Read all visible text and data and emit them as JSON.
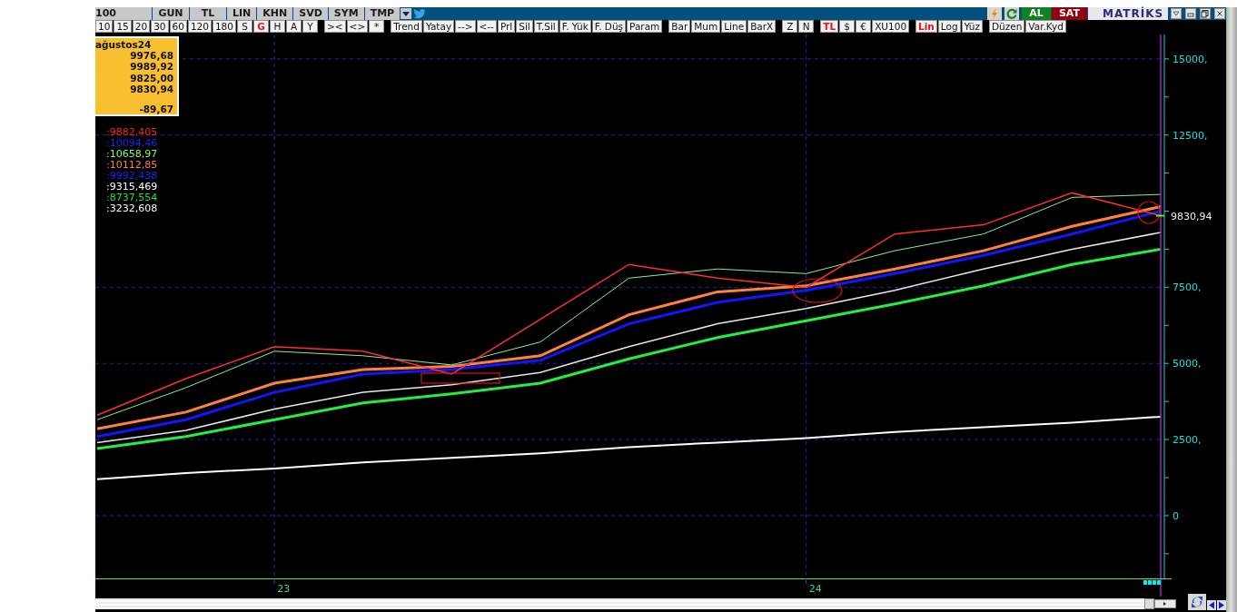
{
  "toolbar_top": {
    "left_items": [
      {
        "label": "100"
      },
      {
        "label": "GUN"
      },
      {
        "label": "TL"
      },
      {
        "label": "LIN"
      },
      {
        "label": "KHN"
      },
      {
        "label": "SVD"
      },
      {
        "label": "SYM"
      },
      {
        "label": "TMP"
      }
    ],
    "right_buttons": [
      {
        "label": "AL",
        "kind": "buy"
      },
      {
        "label": "SAT",
        "kind": "sell"
      }
    ],
    "logo": "MATRİKS"
  },
  "toolbar_bottom": {
    "groups": [
      [
        {
          "label": "10",
          "selected": false
        },
        {
          "label": "15",
          "selected": false
        },
        {
          "label": "20",
          "selected": false
        },
        {
          "label": "30",
          "selected": false
        },
        {
          "label": "60",
          "selected": false
        },
        {
          "label": "120",
          "selected": false
        },
        {
          "label": "180",
          "selected": false
        },
        {
          "label": "S",
          "selected": false
        },
        {
          "label": "G",
          "selected": true
        },
        {
          "label": "H",
          "selected": false
        },
        {
          "label": "A",
          "selected": false
        },
        {
          "label": "Y",
          "selected": false
        }
      ],
      [
        {
          "label": "><",
          "selected": false
        },
        {
          "label": "<>",
          "selected": false
        },
        {
          "label": "*",
          "selected": false
        }
      ],
      [
        {
          "label": "Trend",
          "selected": false
        },
        {
          "label": "Yatay",
          "selected": false
        },
        {
          "label": "-->",
          "selected": false
        },
        {
          "label": "<--",
          "selected": false
        },
        {
          "label": "Prl",
          "selected": false
        },
        {
          "label": "Sil",
          "selected": false
        },
        {
          "label": "T.Sil",
          "selected": false
        },
        {
          "label": "F. Yük",
          "selected": false
        },
        {
          "label": "F. Düş",
          "selected": false
        },
        {
          "label": "Param",
          "selected": false
        }
      ],
      [
        {
          "label": "Bar",
          "selected": false
        },
        {
          "label": "Mum",
          "selected": false
        },
        {
          "label": "Line",
          "selected": false
        },
        {
          "label": "BarX",
          "selected": false
        }
      ],
      [
        {
          "label": "Z",
          "selected": false
        },
        {
          "label": "N",
          "selected": false
        }
      ],
      [
        {
          "label": "TL",
          "selected": true
        },
        {
          "label": "$",
          "selected": false
        },
        {
          "label": "€",
          "selected": false
        },
        {
          "label": "XU100",
          "selected": false
        }
      ],
      [
        {
          "label": "Lin",
          "selected": true
        },
        {
          "label": "Log",
          "selected": false
        },
        {
          "label": "Yüz",
          "selected": false
        }
      ],
      [
        {
          "label": "Düzen",
          "selected": false
        },
        {
          "label": "Var.Kyd",
          "selected": false
        }
      ]
    ]
  },
  "info_box": {
    "title": "ağustos24",
    "values": [
      "9976,68",
      "9989,92",
      "9825,00",
      "9830,94"
    ],
    "change": "-89,67"
  },
  "legend": [
    {
      "value": ":9882,405",
      "color": "#ff2020"
    },
    {
      "value": ":10094,46",
      "color": "#2020ff"
    },
    {
      "value": ":10658,97",
      "color": "#80ff80"
    },
    {
      "value": ":10112,85",
      "color": "#ff7f40"
    },
    {
      "value": ":9992,438",
      "color": "#2020ff"
    },
    {
      "value": ":9315,469",
      "color": "#ffffff"
    },
    {
      "value": ":8737,554",
      "color": "#20e040"
    },
    {
      "value": ":3232,608",
      "color": "#ffffff"
    }
  ],
  "chart": {
    "price_tag": "9830,94",
    "chart_data": {
      "type": "line",
      "categories": [
        null,
        null,
        "23",
        null,
        null,
        null,
        null,
        null,
        "24",
        null,
        null,
        null,
        null
      ],
      "ylim": [
        -2060,
        15800
      ],
      "grid": true,
      "yticks": [
        {
          "value": 15000,
          "label": "15000,"
        },
        {
          "value": 12500,
          "label": "12500,"
        },
        {
          "value": 7500,
          "label": "7500,"
        },
        {
          "value": 5000,
          "label": "5000,"
        },
        {
          "value": 2500,
          "label": "2500,"
        },
        {
          "value": 0,
          "label": "0"
        }
      ],
      "series": [
        {
          "color": "#ff3030",
          "values": [
            3300,
            4500,
            5550,
            5400,
            4650,
            6450,
            8250,
            7800,
            7500,
            9250,
            9550,
            10600,
            9850
          ]
        },
        {
          "color": "#90ee90",
          "values": [
            3150,
            4200,
            5400,
            5250,
            4950,
            5700,
            7800,
            8100,
            7950,
            8700,
            9250,
            10450,
            10550
          ]
        },
        {
          "color": "#ff8040",
          "values": [
            2850,
            3400,
            4350,
            4800,
            4900,
            5250,
            6600,
            7350,
            7550,
            8100,
            8700,
            9500,
            10150
          ]
        },
        {
          "color": "#1414ff",
          "values": [
            2600,
            3150,
            4050,
            4650,
            4800,
            5100,
            6300,
            7000,
            7400,
            7950,
            8550,
            9250,
            10000
          ]
        },
        {
          "color": "#e8e8e8",
          "values": [
            2400,
            2800,
            3500,
            4050,
            4300,
            4700,
            5550,
            6300,
            6800,
            7400,
            8100,
            8750,
            9300
          ]
        },
        {
          "color": "#22ee44",
          "values": [
            2200,
            2600,
            3150,
            3700,
            4000,
            4350,
            5150,
            5850,
            6400,
            6950,
            7550,
            8250,
            8750
          ]
        },
        {
          "color": "#ffffff",
          "values": [
            1200,
            1400,
            1550,
            1750,
            1900,
            2050,
            2250,
            2400,
            2550,
            2750,
            2900,
            3050,
            3250
          ]
        }
      ]
    }
  }
}
